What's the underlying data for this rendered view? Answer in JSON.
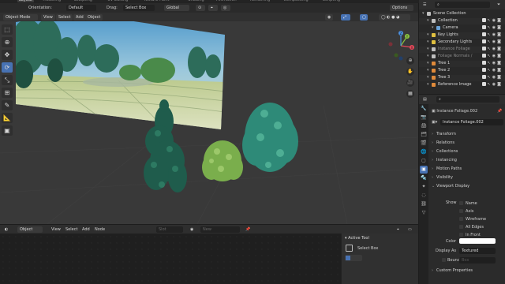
{
  "workspace_tabs": [
    "Layout",
    "Modeling",
    "Sculpting",
    "UV Editing",
    "Texture Paint",
    "Shading",
    "Animation",
    "Rendering",
    "Compositing",
    "Scripting"
  ],
  "workspace_active": "Layout",
  "viewport": {
    "header1": {
      "orientation_label": "Orientation:",
      "orientation_value": "Default",
      "drag_label": "Drag:",
      "drag_value": "Select Box",
      "transform_value": "Global",
      "options_label": "Options"
    },
    "header2": {
      "mode": "Object Mode",
      "menus": [
        "View",
        "Select",
        "Add",
        "Object"
      ]
    },
    "gizmo": {
      "x_label": "X",
      "y_label": "Y",
      "z_label": "Z"
    },
    "tools": [
      "select-box",
      "cursor",
      "move",
      "rotate",
      "scale",
      "transform",
      "annotate",
      "measure",
      "add-cube"
    ]
  },
  "bottom_editor": {
    "editor_type": "Object",
    "menus": [
      "View",
      "Select",
      "Add",
      "Node"
    ],
    "slot_label": "Slot",
    "new_label": "New"
  },
  "active_tool_panel": {
    "title": "Active Tool",
    "tool_name": "Select Box"
  },
  "outliner": {
    "search_placeholder": "",
    "items": [
      {
        "name": "Scene Collection",
        "indent": 0,
        "color": "#bfbfbf",
        "toggles": false,
        "dim": false
      },
      {
        "name": "Collection",
        "indent": 1,
        "color": "#bfbfbf",
        "toggles": true,
        "dim": false
      },
      {
        "name": "Camera",
        "indent": 2,
        "color": "#6aa3d8",
        "toggles": true,
        "dim": false
      },
      {
        "name": "Key Lights",
        "indent": 1,
        "color": "#e0c040",
        "toggles": true,
        "dim": false
      },
      {
        "name": "Secondary Lights",
        "indent": 1,
        "color": "#e0c040",
        "toggles": true,
        "dim": false
      },
      {
        "name": "Instance Foliage",
        "indent": 1,
        "color": "#bfbfbf",
        "toggles": true,
        "dim": true
      },
      {
        "name": "Foliage Normals /",
        "indent": 1,
        "color": "#bfbfbf",
        "toggles": true,
        "dim": true
      },
      {
        "name": "Tree 1",
        "indent": 1,
        "color": "#e08a3a",
        "toggles": true,
        "dim": false
      },
      {
        "name": "Tree 2",
        "indent": 1,
        "color": "#e08a3a",
        "toggles": true,
        "dim": false
      },
      {
        "name": "Tree 3",
        "indent": 1,
        "color": "#e08a3a",
        "toggles": true,
        "dim": false
      },
      {
        "name": "Reference Image",
        "indent": 1,
        "color": "#e08a3a",
        "toggles": true,
        "dim": false
      }
    ]
  },
  "properties": {
    "search_placeholder": "",
    "object_path": "Instance Foliage.002",
    "object_name": "Instance Foliage.002",
    "sections": [
      {
        "label": "Transform",
        "open": false
      },
      {
        "label": "Relations",
        "open": false
      },
      {
        "label": "Collections",
        "open": false
      },
      {
        "label": "Instancing",
        "open": false
      },
      {
        "label": "Motion Paths",
        "open": false
      },
      {
        "label": "Visibility",
        "open": false
      },
      {
        "label": "Viewport Display",
        "open": true
      }
    ],
    "viewport_display": {
      "show_label": "Show",
      "checks": [
        "Name",
        "Axis",
        "Wireframe",
        "All Edges",
        "In Front"
      ],
      "color_label": "Color",
      "color_value": "#ffffff",
      "display_as_label": "Display As",
      "display_as_value": "Textured",
      "bounds_label": "Bounds",
      "bounds_value": "Box"
    },
    "custom_properties_label": "Custom Properties"
  },
  "colors": {
    "accent": "#4772b3",
    "axis_x": "#e8485a",
    "axis_y": "#8ac43f",
    "axis_z": "#4a8fe0"
  }
}
